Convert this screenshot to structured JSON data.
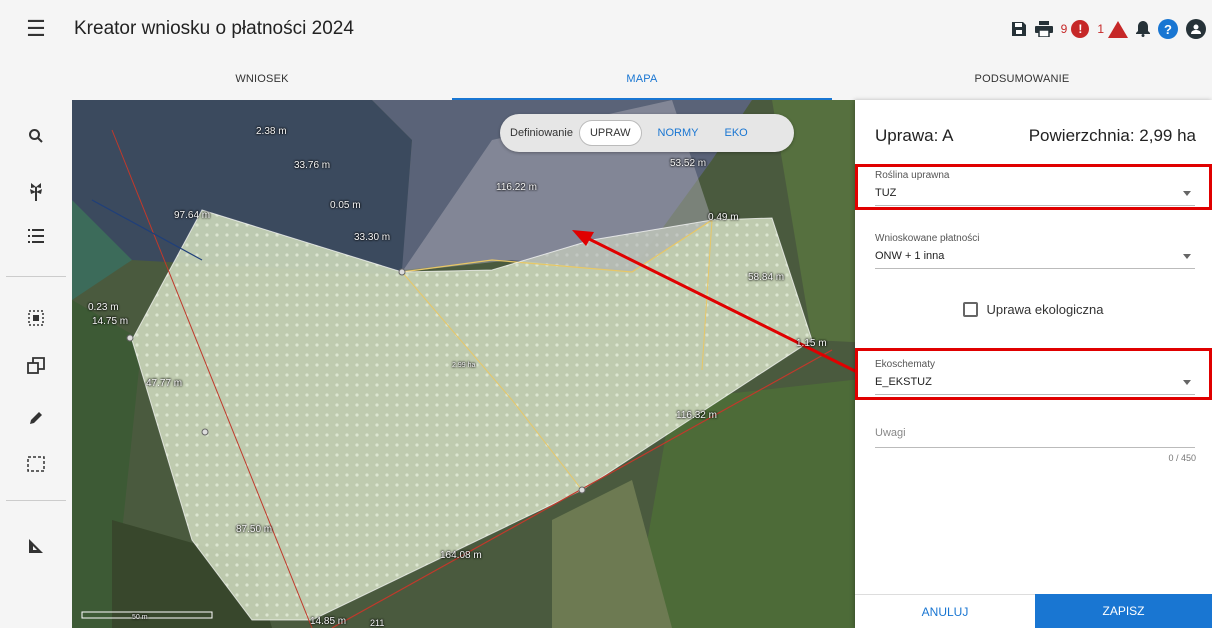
{
  "header": {
    "title": "Kreator wniosku o płatności 2024",
    "icons": [
      "menu-icon",
      "save-icon",
      "print-icon",
      "error-icon",
      "warning-icon",
      "notification-icon",
      "help-icon",
      "account-icon"
    ],
    "error_count": "9",
    "error_symbol": "!",
    "warning_count": "1",
    "help_symbol": "?"
  },
  "tabs": [
    {
      "label": "WNIOSEK",
      "active": false
    },
    {
      "label": "MAPA",
      "active": true
    },
    {
      "label": "PODSUMOWANIE",
      "active": false
    }
  ],
  "sidebar": {
    "icons": [
      "search-icon",
      "plant-icon",
      "list-icon",
      "select-area-icon",
      "copy-icon",
      "pencil-icon",
      "rectangle-select-icon",
      "measure-icon"
    ]
  },
  "map": {
    "toggle": {
      "label": "Definiowanie",
      "options": [
        "UPRAW",
        "NORMY",
        "EKO"
      ],
      "active": "UPRAW"
    },
    "labels": {
      "l1": "2.38 m",
      "l2": "33.76 m",
      "l3": "0.05 m",
      "l4": "116.22 m",
      "l5": "53.52 m",
      "l6": "97.64 m",
      "l7": "33.30 m",
      "l8": "0.49 m",
      "l9": "58.84 m",
      "l10": "0.23 m",
      "l11": "14.75 m",
      "l12": "2.99 ha",
      "l13": "1.15 m",
      "l14": "47.77 m",
      "l15": "116.32 m",
      "l16": "87.50 m",
      "l17": "164.08 m",
      "l18": "14.85 m",
      "l19": "211",
      "scale": "50 m"
    },
    "colors": {
      "parcel_fill": "#c9d5b8",
      "arrow": "#e00000",
      "boundary": "#e8c766"
    }
  },
  "panel": {
    "title": "Uprawa: A",
    "area": "Powierzchnia: 2,99 ha",
    "crop": {
      "label": "Roślina uprawna",
      "value": "TUZ"
    },
    "payments": {
      "label": "Wnioskowane płatności",
      "value": "ONW + 1 inna"
    },
    "eco_checkbox": {
      "label": "Uprawa ekologiczna",
      "checked": false
    },
    "ecoschemes": {
      "label": "Ekoschematy",
      "value": "E_EKSTUZ"
    },
    "notes": {
      "label": "Uwagi",
      "counter": "0 / 450"
    },
    "cancel_label": "ANULUJ",
    "save_label": "ZAPISZ"
  }
}
